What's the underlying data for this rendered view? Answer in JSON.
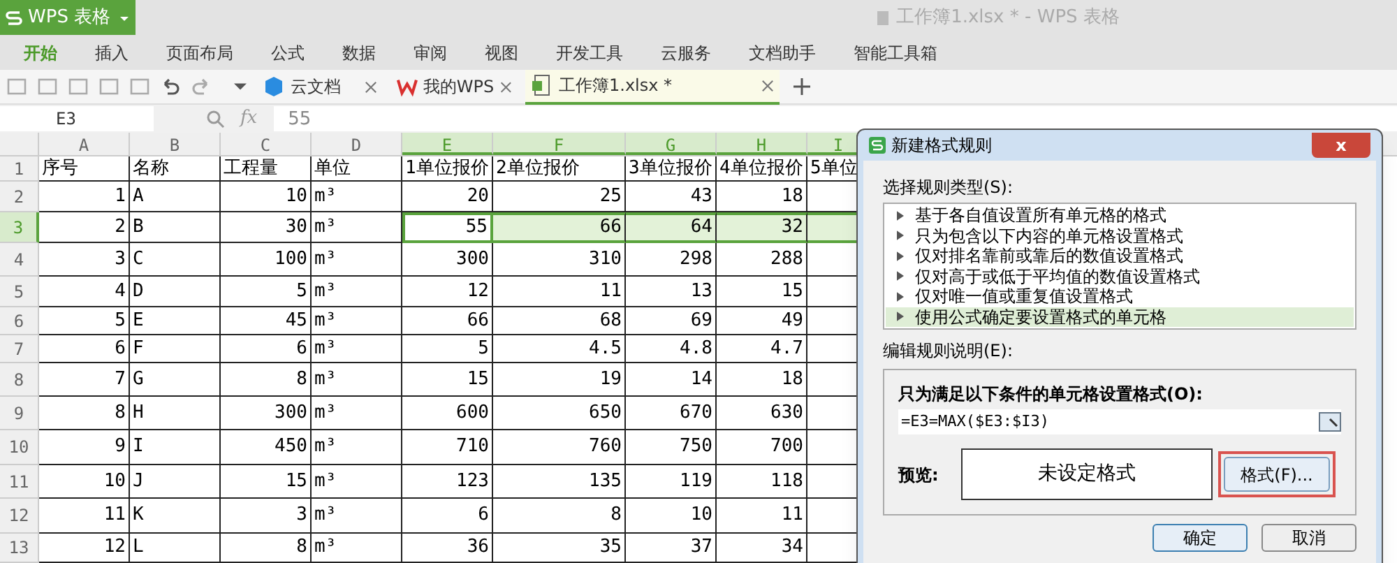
{
  "app": {
    "name": "WPS 表格",
    "title": "工作簿1.xlsx * - WPS 表格"
  },
  "menu": [
    {
      "label": "开始",
      "selected": true
    },
    {
      "label": "插入",
      "selected": false
    },
    {
      "label": "页面布局",
      "selected": false
    },
    {
      "label": "公式",
      "selected": false
    },
    {
      "label": "数据",
      "selected": false
    },
    {
      "label": "审阅",
      "selected": false
    },
    {
      "label": "视图",
      "selected": false
    },
    {
      "label": "开发工具",
      "selected": false
    },
    {
      "label": "云服务",
      "selected": false
    },
    {
      "label": "文档助手",
      "selected": false
    },
    {
      "label": "智能工具箱",
      "selected": false
    }
  ],
  "doc_tabs": [
    {
      "label": "云文档",
      "kind": "cloud",
      "selected": false
    },
    {
      "label": "我的WPS",
      "kind": "wps",
      "selected": false
    },
    {
      "label": "工作簿1.xlsx *",
      "kind": "sheet",
      "selected": true
    }
  ],
  "formula_bar": {
    "name_box": "E3",
    "fx": "fx",
    "value": "55"
  },
  "columns": [
    {
      "label": "A",
      "selected": false
    },
    {
      "label": "B",
      "selected": false
    },
    {
      "label": "C",
      "selected": false
    },
    {
      "label": "D",
      "selected": false
    },
    {
      "label": "E",
      "selected": true
    },
    {
      "label": "F",
      "selected": true
    },
    {
      "label": "G",
      "selected": true
    },
    {
      "label": "H",
      "selected": true
    },
    {
      "label": "I",
      "selected": true
    }
  ],
  "rows": [
    {
      "num": "1",
      "selected": false,
      "cells": [
        "序号",
        "名称",
        "工程量",
        "单位",
        "1单位报价",
        "2单位报价",
        "3单位报价",
        "4单位报价",
        "5单位"
      ]
    },
    {
      "num": "2",
      "selected": false,
      "cells": [
        "1",
        "A",
        "10",
        "m³",
        "20",
        "25",
        "43",
        "18",
        ""
      ]
    },
    {
      "num": "3",
      "selected": true,
      "cells": [
        "2",
        "B",
        "30",
        "m³",
        "55",
        "66",
        "64",
        "32",
        ""
      ]
    },
    {
      "num": "4",
      "selected": false,
      "cells": [
        "3",
        "C",
        "100",
        "m³",
        "300",
        "310",
        "298",
        "288",
        ""
      ]
    },
    {
      "num": "5",
      "selected": false,
      "cells": [
        "4",
        "D",
        "5",
        "m³",
        "12",
        "11",
        "13",
        "15",
        ""
      ]
    },
    {
      "num": "6",
      "selected": false,
      "cells": [
        "5",
        "E",
        "45",
        "m³",
        "66",
        "68",
        "69",
        "49",
        ""
      ]
    },
    {
      "num": "7",
      "selected": false,
      "cells": [
        "6",
        "F",
        "6",
        "m³",
        "5",
        "4.5",
        "4.8",
        "4.7",
        ""
      ]
    },
    {
      "num": "8",
      "selected": false,
      "cells": [
        "7",
        "G",
        "8",
        "m³",
        "15",
        "19",
        "14",
        "18",
        ""
      ]
    },
    {
      "num": "9",
      "selected": false,
      "cells": [
        "8",
        "H",
        "300",
        "m³",
        "600",
        "650",
        "670",
        "630",
        ""
      ]
    },
    {
      "num": "10",
      "selected": false,
      "cells": [
        "9",
        "I",
        "450",
        "m³",
        "710",
        "760",
        "750",
        "700",
        ""
      ]
    },
    {
      "num": "11",
      "selected": false,
      "cells": [
        "10",
        "J",
        "15",
        "m³",
        "123",
        "135",
        "119",
        "118",
        ""
      ]
    },
    {
      "num": "12",
      "selected": false,
      "cells": [
        "11",
        "K",
        "3",
        "m³",
        "6",
        "8",
        "10",
        "11",
        ""
      ]
    },
    {
      "num": "13",
      "selected": false,
      "cells": [
        "12",
        "L",
        "8",
        "m³",
        "36",
        "35",
        "37",
        "34",
        ""
      ]
    }
  ],
  "dialog": {
    "title": "新建格式规则",
    "close": "x",
    "type_label": "选择规则类型(S):",
    "rule_types": [
      {
        "label": "基于各自值设置所有单元格的格式",
        "selected": false
      },
      {
        "label": "只为包含以下内容的单元格设置格式",
        "selected": false
      },
      {
        "label": "仅对排名靠前或靠后的数值设置格式",
        "selected": false
      },
      {
        "label": "仅对高于或低于平均值的数值设置格式",
        "selected": false
      },
      {
        "label": "仅对唯一值或重复值设置格式",
        "selected": false
      },
      {
        "label": "使用公式确定要设置格式的单元格",
        "selected": true
      }
    ],
    "edit_label": "编辑规则说明(E):",
    "condition_label": "只为满足以下条件的单元格设置格式(O):",
    "formula": "=E3=MAX($E3:$I3)",
    "preview_label": "预览:",
    "preview_text": "未设定格式",
    "format_button": "格式(F)...",
    "ok": "确定",
    "cancel": "取消"
  }
}
